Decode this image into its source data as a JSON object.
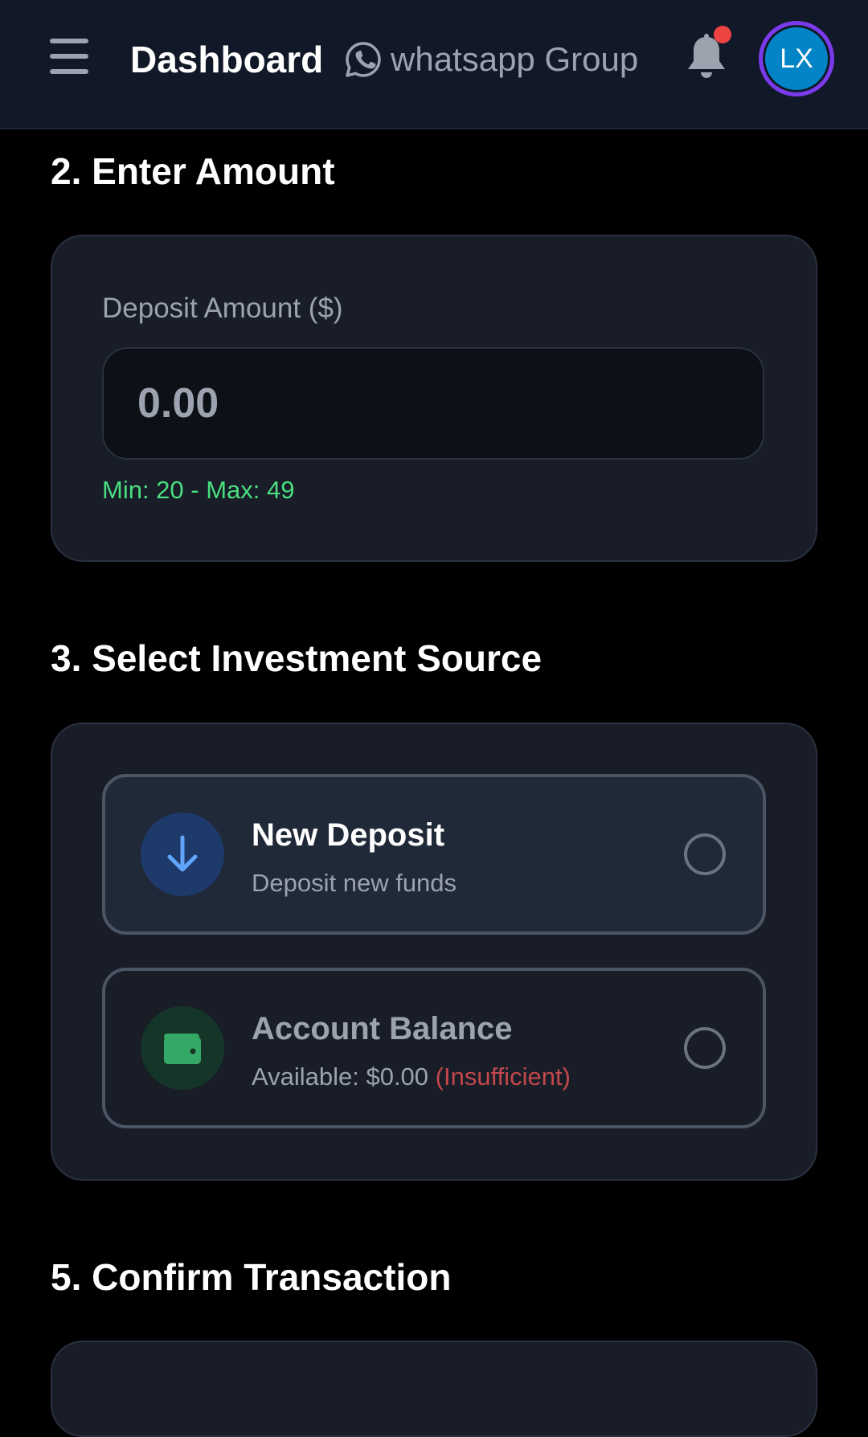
{
  "header": {
    "title": "Dashboard",
    "whatsapp_label": "whatsapp Group",
    "avatar_initials": "LX",
    "icons": [
      "menu-icon",
      "whatsapp-icon",
      "bell-icon"
    ],
    "colors": {
      "background": "#111827",
      "notification_dot": "#ef4444",
      "avatar_bg": "#0284c7",
      "avatar_ring": "#7c3aed"
    }
  },
  "amount_section": {
    "title": "2. Enter Amount",
    "field_label": "Deposit Amount ($)",
    "input_placeholder": "0.00",
    "input_value": "",
    "limits": "Min: 20 - Max: 49"
  },
  "source_section": {
    "title": "3. Select Investment Source",
    "options": [
      {
        "title": "New Deposit",
        "subtitle": "Deposit new funds",
        "icon": "arrow-down-icon",
        "selected": false
      },
      {
        "title": "Account Balance",
        "subtitle": "Available: $0.00",
        "subtitle_warning": "(Insufficient)",
        "icon": "wallet-icon",
        "selected": false
      }
    ]
  },
  "confirm_section": {
    "title": "5. Confirm Transaction"
  }
}
